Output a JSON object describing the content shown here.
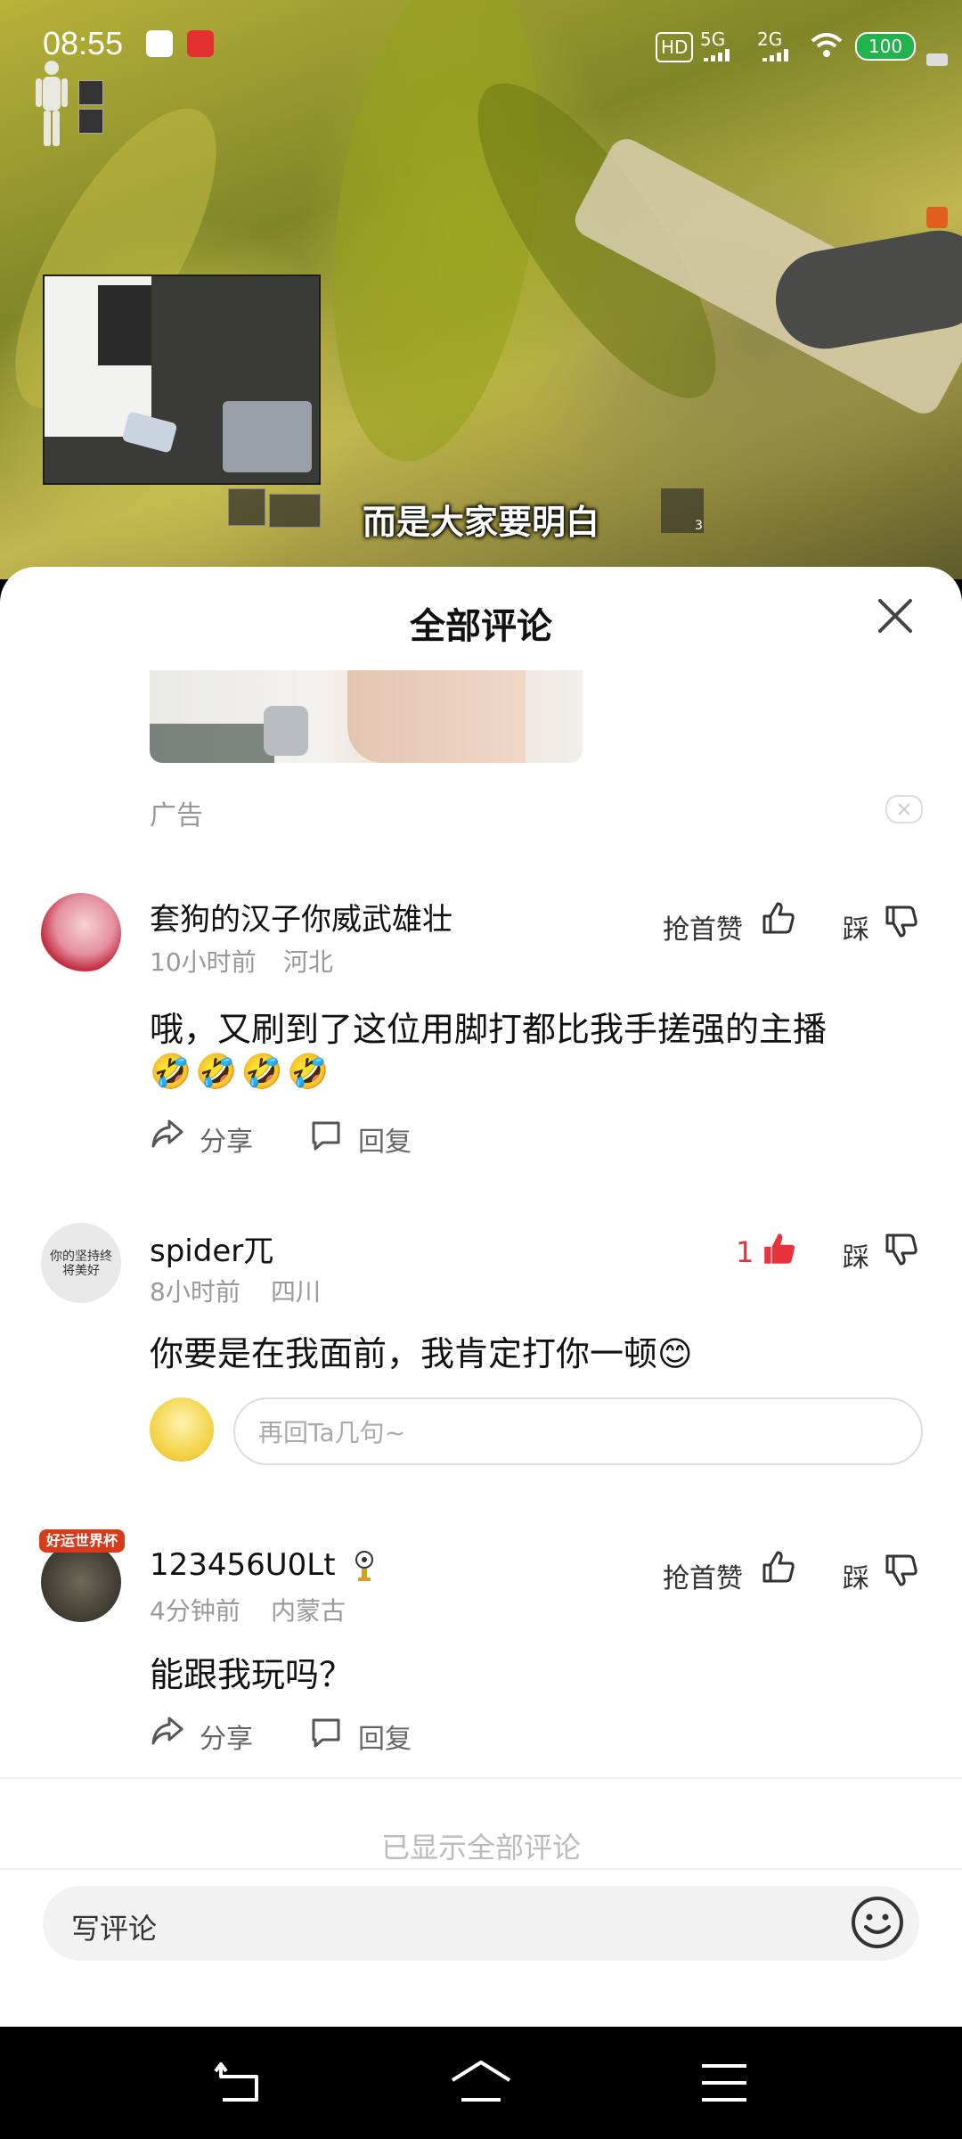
{
  "status_bar": {
    "time": "08:55",
    "hd": "HD",
    "net1": "5G",
    "net2": "2G",
    "battery": "100"
  },
  "video": {
    "subtitle": "而是大家要明白",
    "hud_count": "3"
  },
  "sheet": {
    "title": "全部评论",
    "ad_label": "广告"
  },
  "comments": [
    {
      "name": "套狗的汉子你威武雄壮",
      "time": "10小时前",
      "location": "河北",
      "like_label": "抢首赞",
      "dislike_label": "踩",
      "text_line1": "哦，又刷到了这位用脚打都比我手搓强的主播",
      "text_line2": "🤣🤣🤣🤣",
      "share_label": "分享",
      "reply_label": "回复"
    },
    {
      "name": "spider兀",
      "avatar_text": "你的坚持终将美好",
      "time": "8小时前",
      "location": "四川",
      "like_count": "1",
      "dislike_label": "踩",
      "text": "你要是在我面前，我肯定打你一顿😊",
      "reply_placeholder": "再回Ta几句~"
    },
    {
      "name": "123456U0Lt",
      "badge": "好运世界杯",
      "time": "4分钟前",
      "location": "内蒙古",
      "like_label": "抢首赞",
      "dislike_label": "踩",
      "text": "能跟我玩吗？",
      "share_label": "分享",
      "reply_label": "回复"
    }
  ],
  "footer": {
    "end_text": "已显示全部评论",
    "input_placeholder": "写评论"
  },
  "colors": {
    "like_active": "#e8323c",
    "text_primary": "#111111",
    "text_meta": "#999999"
  }
}
